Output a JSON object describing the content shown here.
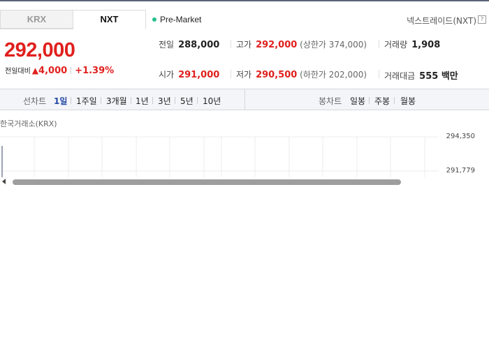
{
  "tabs": [
    {
      "label": "KRX"
    },
    {
      "label": "NXT"
    }
  ],
  "session": {
    "label": "Pre-Market",
    "dot_color": "#25c08c"
  },
  "exchange": {
    "name": "넥스트레이드(NXT)",
    "help": "?"
  },
  "quote": {
    "price": "292,000",
    "change_label": "전일대비",
    "change_abs": "4,000",
    "change_pct": "+1.39%",
    "color_up": "#e0201d"
  },
  "stats": {
    "prev_close": {
      "label": "전일",
      "value": "288,000"
    },
    "high": {
      "label": "고가",
      "value": "292,000",
      "sub": "(상한가 374,000)"
    },
    "volume": {
      "label": "거래량",
      "value": "1,908"
    },
    "open": {
      "label": "시가",
      "value": "291,000"
    },
    "low": {
      "label": "저가",
      "value": "290,500",
      "sub": "(하한가 202,000)"
    },
    "amount": {
      "label": "거래대금",
      "value": "555 백만"
    }
  },
  "toolbar": {
    "line_chart_label": "선차트",
    "periods": [
      "1일",
      "1주일",
      "3개월",
      "1년",
      "3년",
      "5년",
      "10년"
    ],
    "active_period": "1일",
    "candle_chart_label": "봉차트",
    "candle_periods": [
      "일봉",
      "주봉",
      "월봉"
    ]
  },
  "chart": {
    "source": "한국거래소(KRX)",
    "y_ticks": [
      "294,350",
      "291,779"
    ]
  }
}
